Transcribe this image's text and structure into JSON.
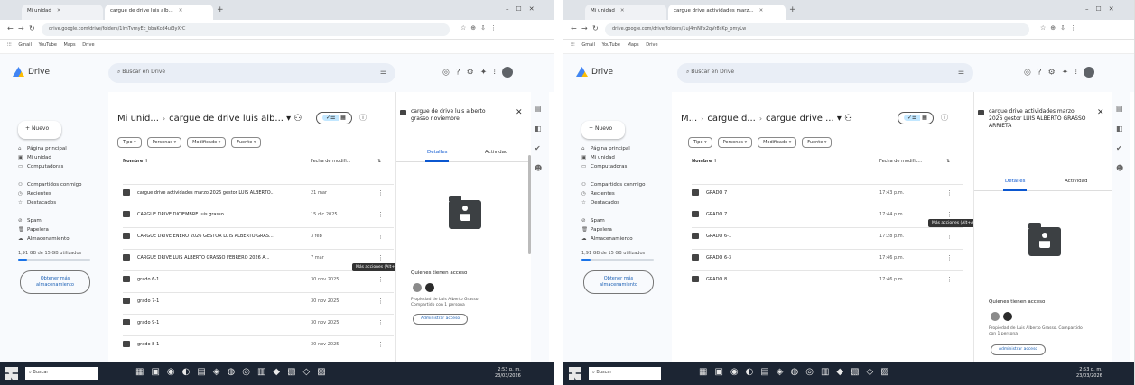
{
  "left": {
    "browser": {
      "tabs": [
        "Mi unidad",
        "cargue de drive luis alb..."
      ],
      "url": "drive.google.com/drive/folders/1lmTvmyEc_bbaKcd4ui3yXrC",
      "bookmarks": [
        "Gmail",
        "YouTube",
        "Maps",
        "Drive"
      ]
    },
    "drive": {
      "logo": "Drive",
      "search_placeholder": "Buscar en Drive",
      "new_label": "Nuevo",
      "nav": [
        {
          "icon": "⌂",
          "label": "Página principal"
        },
        {
          "icon": "▣",
          "label": "Mi unidad"
        },
        {
          "icon": "▭",
          "label": "Computadoras"
        },
        {
          "icon": "⚇",
          "label": "Compartidos conmigo"
        },
        {
          "icon": "◷",
          "label": "Recientes"
        },
        {
          "icon": "☆",
          "label": "Destacados"
        },
        {
          "icon": "⊘",
          "label": "Spam"
        },
        {
          "icon": "🗑",
          "label": "Papelera"
        },
        {
          "icon": "☁",
          "label": "Almacenamiento"
        }
      ],
      "storage_text": "1,91 GB de 15 GB utilizados",
      "storage_fraction": 0.13,
      "storage_button": "Obtener más almacenamiento",
      "breadcrumb": [
        "Mi unid...",
        "cargue de drive luis alb..."
      ],
      "filters": [
        "Tipo",
        "Personas",
        "Modificado",
        "Fuente"
      ],
      "col_name": "Nombre",
      "col_modified": "Fecha de modifi...",
      "files": [
        {
          "name": "cargue drive actividades marzo 2026 gestor LUIS ALBERTO...",
          "date": "21 mar"
        },
        {
          "name": "CARGUE DRIVE DICIEMBRE luis grasso",
          "date": "15 dic 2025"
        },
        {
          "name": "CARGUE DRIVE ENERO 2026 GESTOR LUIS ALBERTO GRAS...",
          "date": "3 feb"
        },
        {
          "name": "CARGUE DRIVE LUIS ALBERTO GRASSO FEBRERO 2026 A...",
          "date": "7 mar"
        },
        {
          "name": "grado 6-1",
          "date": "30 nov 2025"
        },
        {
          "name": "grado 7-1",
          "date": "30 nov 2025"
        },
        {
          "name": "grado 9-1",
          "date": "30 nov 2025"
        },
        {
          "name": "grado 8-1",
          "date": "30 nov 2025"
        }
      ],
      "tooltip": "Más acciones (Alt+A)",
      "detail": {
        "title": "cargue de drive luis alberto grasso noviembre",
        "tabs": [
          "Detalles",
          "Actividad"
        ],
        "access_heading": "Quienes tienen acceso",
        "access_note": "Propiedad de Luis Alberto Grasso. Compartido con 1 persona",
        "manage_button": "Administrar acceso"
      }
    },
    "taskbar": {
      "search": "Buscar",
      "time": "2:53 p. m.",
      "date": "23/03/2026"
    }
  },
  "right": {
    "browser": {
      "tabs": [
        "Mi unidad",
        "cargue drive actividades marz..."
      ],
      "url": "drive.google.com/drive/folders/1uJ4mNFx2qVr8sKp_pmyLw",
      "bookmarks": [
        "Gmail",
        "YouTube",
        "Maps",
        "Drive"
      ]
    },
    "drive": {
      "logo": "Drive",
      "search_placeholder": "Buscar en Drive",
      "new_label": "Nuevo",
      "nav": [
        {
          "icon": "⌂",
          "label": "Página principal"
        },
        {
          "icon": "▣",
          "label": "Mi unidad"
        },
        {
          "icon": "▭",
          "label": "Computadoras"
        },
        {
          "icon": "⚇",
          "label": "Compartidos conmigo"
        },
        {
          "icon": "◷",
          "label": "Recientes"
        },
        {
          "icon": "☆",
          "label": "Destacados"
        },
        {
          "icon": "⊘",
          "label": "Spam"
        },
        {
          "icon": "🗑",
          "label": "Papelera"
        },
        {
          "icon": "☁",
          "label": "Almacenamiento"
        }
      ],
      "storage_text": "1,91 GB de 15 GB utilizados",
      "storage_fraction": 0.13,
      "storage_button": "Obtener más almacenamiento",
      "breadcrumb": [
        "M...",
        "cargue d...",
        "cargue drive ..."
      ],
      "filters": [
        "Tipo",
        "Personas",
        "Modificado",
        "Fuente"
      ],
      "col_name": "Nombre",
      "col_modified": "Fecha de modific...",
      "files": [
        {
          "name": "GRADO 7",
          "date": "17:43 p.m."
        },
        {
          "name": "GRADO 7",
          "date": "17:44 p.m."
        },
        {
          "name": "GRADO 6-1",
          "date": "17:28 p.m."
        },
        {
          "name": "GRADO 6-3",
          "date": "17:46 p.m."
        },
        {
          "name": "GRADO 8",
          "date": "17:46 p.m."
        }
      ],
      "tooltip": "Más acciones (Alt+A)",
      "detail": {
        "title": "cargue drive actividades marzo 2026 gestor LUIS ALBERTO GRASSO ARRIETA",
        "tabs": [
          "Detalles",
          "Actividad"
        ],
        "access_heading": "Quienes tienen acceso",
        "access_note": "Propiedad de Luis Alberto Grasso. Compartido con 1 persona",
        "manage_button": "Administrar acceso"
      }
    },
    "taskbar": {
      "search": "Buscar",
      "time": "2:53 p. m.",
      "date": "23/03/2026"
    }
  }
}
